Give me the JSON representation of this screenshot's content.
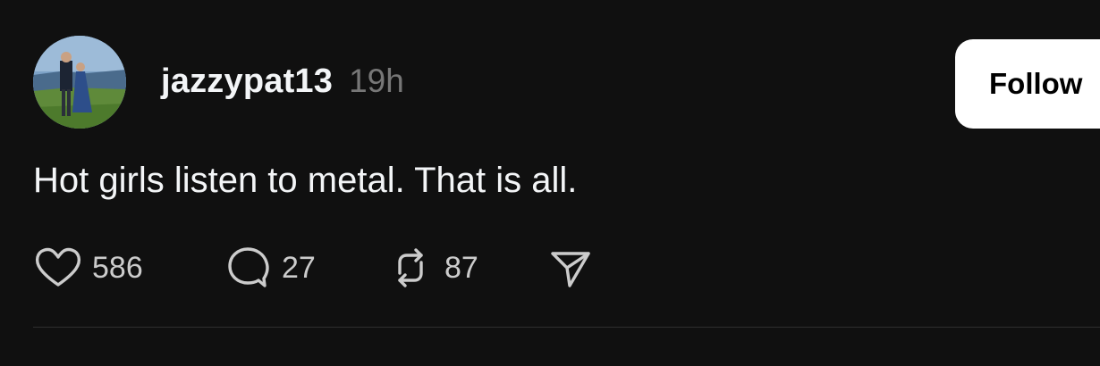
{
  "post": {
    "username": "jazzypat13",
    "timestamp": "19h",
    "text": "Hot girls listen to metal. That is all.",
    "follow_label": "Follow",
    "actions": {
      "likes": "586",
      "replies": "27",
      "reposts": "87"
    },
    "icons": {
      "like": "heart-icon",
      "reply": "speech-bubble-icon",
      "repost": "repost-arrows-icon",
      "share": "send-icon"
    }
  },
  "colors": {
    "background": "#101010",
    "text_primary": "#f3f5f7",
    "text_secondary": "#777777",
    "follow_button_bg": "#ffffff",
    "follow_button_text": "#000000"
  }
}
